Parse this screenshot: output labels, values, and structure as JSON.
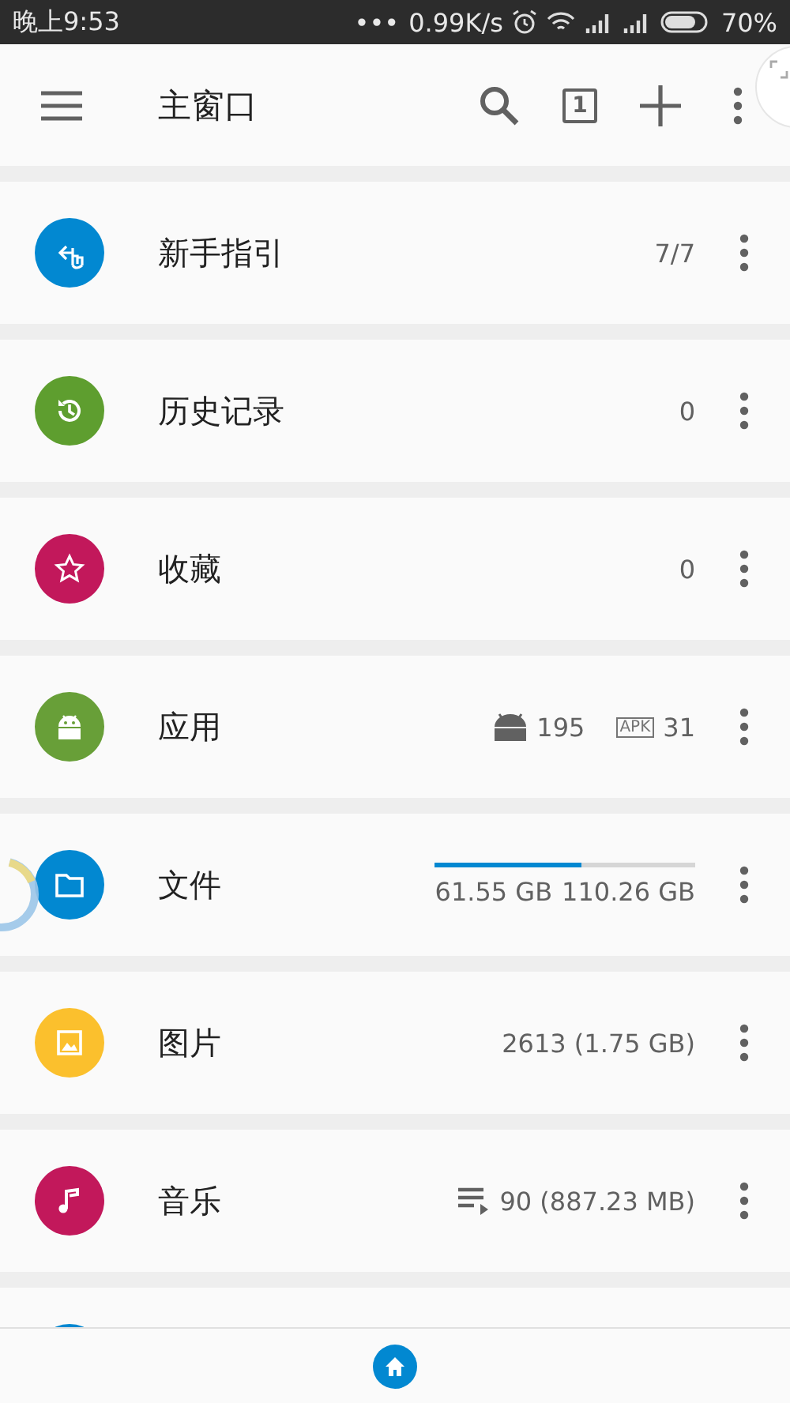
{
  "status_bar": {
    "time": "晚上9:53",
    "dots": "•••",
    "speed": "0.99K/s",
    "battery": "70%"
  },
  "toolbar": {
    "title": "主窗口",
    "tab_count": "1"
  },
  "items": [
    {
      "title": "新手指引",
      "color": "#0288d1",
      "kind": "count",
      "count": "7/7"
    },
    {
      "title": "历史记录",
      "color": "#5e9e2f",
      "kind": "count",
      "count": "0"
    },
    {
      "title": "收藏",
      "color": "#c2185b",
      "kind": "count",
      "count": "0"
    },
    {
      "title": "应用",
      "color": "#689f38",
      "kind": "apps",
      "installed": "195",
      "apk": "APK",
      "apk_count": "31"
    },
    {
      "title": "文件",
      "color": "#0288d1",
      "kind": "storage",
      "level": 0.56,
      "used": "61.55 GB",
      "total": "110.26 GB"
    },
    {
      "title": "图片",
      "color": "#fbc02d",
      "kind": "count",
      "count": "2613 (1.75 GB)"
    },
    {
      "title": "音乐",
      "color": "#c2185b",
      "kind": "music",
      "count": "90 (887.23 MB)"
    }
  ]
}
